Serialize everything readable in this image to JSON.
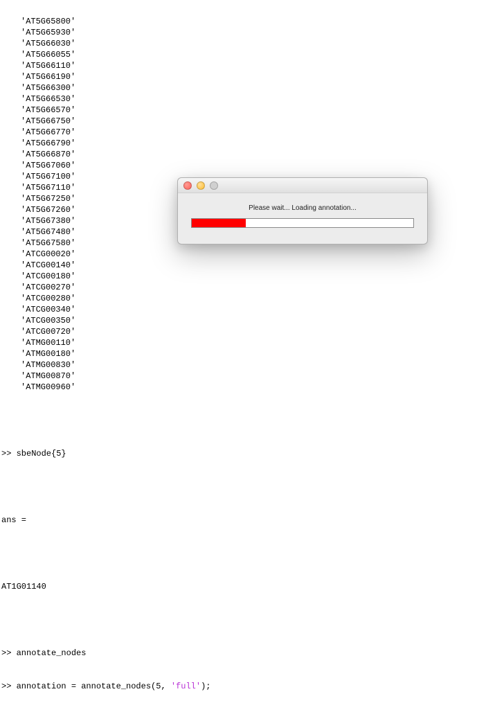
{
  "genes": [
    "'AT5G65800'",
    "'AT5G65930'",
    "'AT5G66030'",
    "'AT5G66055'",
    "'AT5G66110'",
    "'AT5G66190'",
    "'AT5G66300'",
    "'AT5G66530'",
    "'AT5G66570'",
    "'AT5G66750'",
    "'AT5G66770'",
    "'AT5G66790'",
    "'AT5G66870'",
    "'AT5G67060'",
    "'AT5G67100'",
    "'AT5G67110'",
    "'AT5G67250'",
    "'AT5G67260'",
    "'AT5G67380'",
    "'AT5G67480'",
    "'AT5G67580'",
    "'ATCG00020'",
    "'ATCG00140'",
    "'ATCG00180'",
    "'ATCG00270'",
    "'ATCG00280'",
    "'ATCG00340'",
    "'ATCG00350'",
    "'ATCG00720'",
    "'ATMG00110'",
    "'ATMG00180'",
    "'ATMG00830'",
    "'ATMG00870'",
    "'ATMG00960'"
  ],
  "lines": {
    "sbeNode": ">> sbeNode{5}",
    "ans": "ans =",
    "ansVal": "AT1G01140",
    "annotate": ">> annotate_nodes",
    "annotCallPre": ">> annotation = annotate_nodes(5, ",
    "annotArg": "'full'",
    "annotCallPost": ");"
  },
  "dialog": {
    "text": "Please wait... Loading annotation...",
    "progressPercent": 24.5
  }
}
